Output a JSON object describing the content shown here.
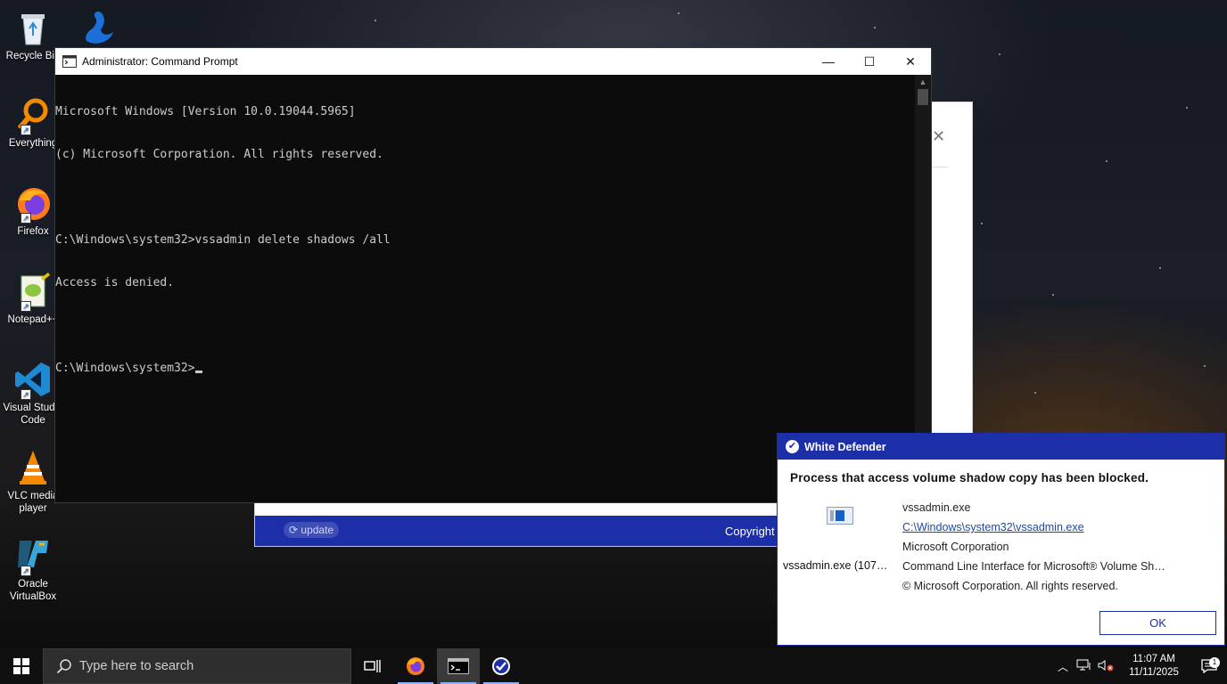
{
  "desktop_icons": [
    {
      "name": "recycle-bin",
      "label": "Recycle Bin"
    },
    {
      "name": "everything",
      "label": "Everything"
    },
    {
      "name": "firefox",
      "label": "Firefox"
    },
    {
      "name": "notepadpp",
      "label": "Notepad++"
    },
    {
      "name": "vscode",
      "label": "Visual Studio Code"
    },
    {
      "name": "vlc",
      "label": "VLC media player"
    },
    {
      "name": "virtualbox",
      "label": "Oracle VirtualBox"
    }
  ],
  "cmd": {
    "title": "Administrator: Command Prompt",
    "lines": [
      "Microsoft Windows [Version 10.0.19044.5965]",
      "(c) Microsoft Corporation. All rights reserved.",
      "",
      "C:\\Windows\\system32>vssadmin delete shadows /all",
      "Access is denied.",
      "",
      "C:\\Windows\\system32>"
    ],
    "minimize": "—",
    "maximize": "☐",
    "close": "✕"
  },
  "background_window": {
    "close": "✕"
  },
  "update_panel": {
    "update_label": "update",
    "copyright": "Copyright"
  },
  "defender": {
    "title": "White Defender",
    "heading": "Process that access volume shadow copy has been blocked.",
    "app_name": "vssadmin.exe (107…",
    "details": {
      "file": "vssadmin.exe",
      "path": "C:\\Windows\\system32\\vssadmin.exe",
      "company": "Microsoft Corporation",
      "description": "Command Line Interface for Microsoft® Volume Sh…",
      "copyright": "© Microsoft Corporation. All rights reserved."
    },
    "ok": "OK",
    "accent": "#1d2fa8"
  },
  "taskbar": {
    "search_placeholder": "Type here to search",
    "time": "11:07 AM",
    "date": "11/11/2025",
    "notification_count": "1"
  }
}
